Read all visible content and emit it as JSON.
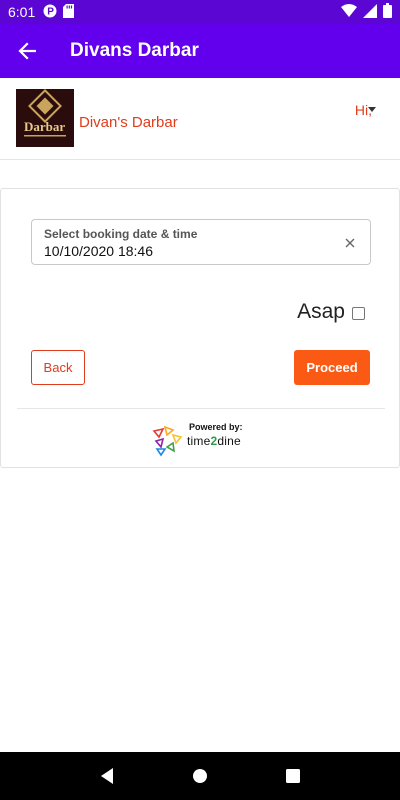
{
  "status_bar": {
    "time": "6:01",
    "icons": [
      "notification-icon",
      "sd-card-icon",
      "wifi-icon",
      "signal-icon",
      "battery-icon"
    ]
  },
  "app_bar": {
    "title": "Divans Darbar",
    "nav_icon": "back-arrow-icon"
  },
  "header": {
    "logo_text": "Darbar",
    "restaurant_name": "Divan's Darbar",
    "greeting": "Hi,"
  },
  "booking": {
    "date_label": "Select booking date & time",
    "date_value": "10/10/2020 18:46",
    "asap_label": "Asap",
    "asap_checked": false,
    "back_label": "Back",
    "proceed_label": "Proceed"
  },
  "footer": {
    "powered_by": "Powered by:",
    "brand_part1": "time",
    "brand_part2": "2",
    "brand_part3": "dine"
  },
  "colors": {
    "app_bar": "#6200ee",
    "status_bar": "#5b06d3",
    "accent_text": "#e13c1b",
    "proceed_bg": "#fa5a13"
  }
}
